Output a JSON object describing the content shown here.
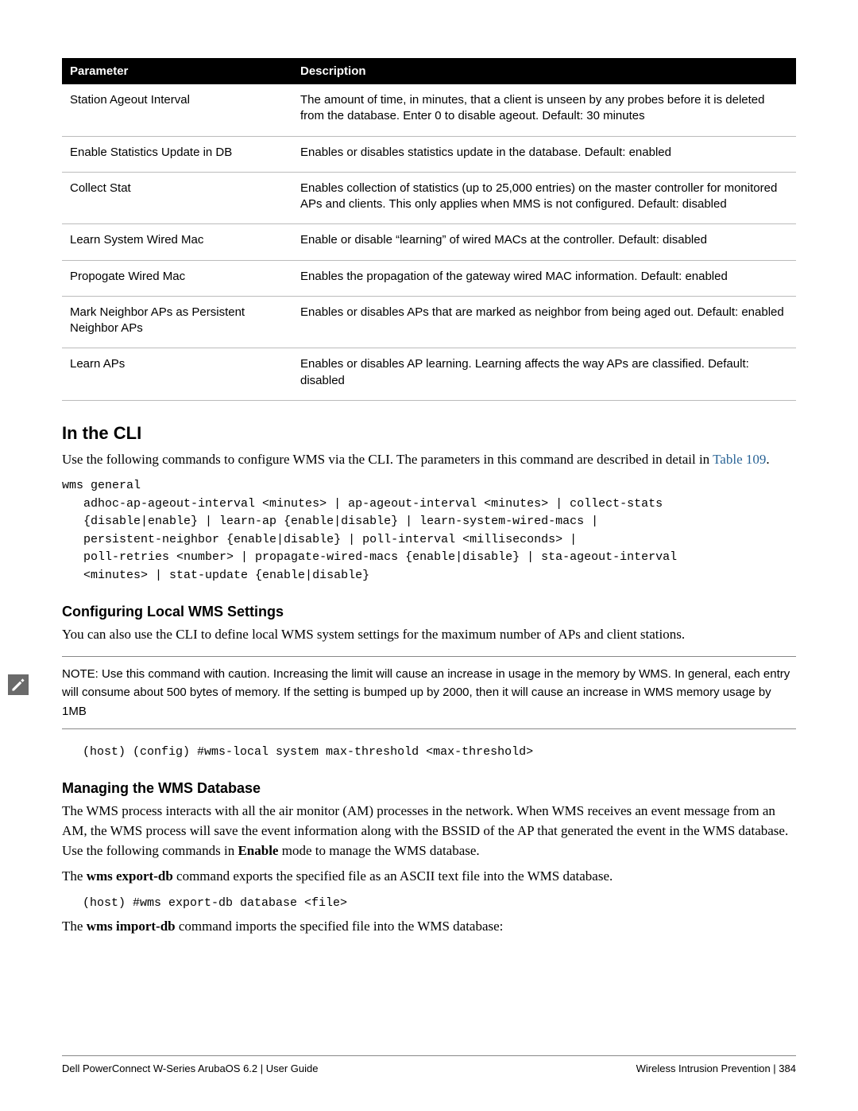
{
  "table": {
    "headers": {
      "param": "Parameter",
      "desc": "Description"
    },
    "rows": [
      {
        "param": "Station Ageout Interval",
        "desc": "The amount of time, in minutes, that a client is unseen by any probes before it is deleted from the database. Enter 0 to disable ageout.\nDefault: 30 minutes"
      },
      {
        "param": "Enable Statistics Update in DB",
        "desc": "Enables or disables statistics update in the database.\nDefault: enabled"
      },
      {
        "param": "Collect Stat",
        "desc": "Enables collection of statistics (up to 25,000 entries) on the master controller for monitored APs and clients. This only applies when MMS is not configured.\nDefault: disabled"
      },
      {
        "param": "Learn System Wired Mac",
        "desc": "Enable or disable “learning” of wired MACs at the controller.\nDefault: disabled"
      },
      {
        "param": "Propogate Wired Mac",
        "desc": "Enables the propagation of the gateway wired MAC information.\nDefault: enabled"
      },
      {
        "param": "Mark Neighbor APs as Persistent Neighbor APs",
        "desc": "Enables or disables APs that are marked as neighbor from being aged out.\nDefault: enabled"
      },
      {
        "param": "Learn APs",
        "desc": "Enables or disables AP learning. Learning affects the way APs are classified.\nDefault: disabled"
      }
    ]
  },
  "sections": {
    "cli_heading": "In the CLI",
    "cli_intro_pre": "Use the following commands to configure WMS via the CLI. The parameters in this command are described in detail in ",
    "cli_intro_link": "Table 109",
    "cli_intro_post": ".",
    "cli_block": "wms general\n   adhoc-ap-ageout-interval <minutes> | ap-ageout-interval <minutes> | collect-stats\n   {disable|enable} | learn-ap {enable|disable} | learn-system-wired-macs |\n   persistent-neighbor {enable|disable} | poll-interval <milliseconds> |\n   poll-retries <number> | propagate-wired-macs {enable|disable} | sta-ageout-interval\n   <minutes> | stat-update {enable|disable}",
    "local_heading": "Configuring Local WMS Settings",
    "local_body": "You can also use the CLI to define local WMS system settings for the maximum number of APs and client stations.",
    "note_text": "NOTE: Use this command with caution. Increasing the limit will cause an increase in usage in the memory by WMS. In general, each entry will consume about 500 bytes of memory. If the setting is bumped up by 2000, then it will cause an increase in WMS memory usage by 1MB",
    "local_cli": "(host) (config) #wms-local system max-threshold <max-threshold>",
    "db_heading": "Managing the WMS Database",
    "db_body1": "The WMS process interacts with all the air monitor (AM) processes in the network. When WMS receives an event message from an AM, the WMS process will save the event information along with the BSSID of the AP that generated the event in the WMS database. Use the following commands in ",
    "db_body1_bold": "Enable",
    "db_body1_tail": " mode to manage the WMS database.",
    "db_export_pre": "The ",
    "db_export_bold": "wms export-db",
    "db_export_post": " command exports the specified file as an ASCII text file into the WMS database.",
    "db_export_cli": "(host) #wms export-db database <file>",
    "db_import_pre": "The ",
    "db_import_bold": "wms import-db",
    "db_import_post": " command imports the specified file into the WMS database:"
  },
  "footer": {
    "left": "Dell PowerConnect W-Series ArubaOS 6.2 | User Guide",
    "right_section": "Wireless Intrusion Prevention",
    "page": "384"
  }
}
